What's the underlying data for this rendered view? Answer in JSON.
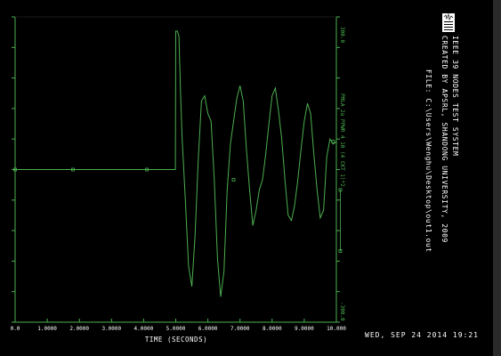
{
  "chart_data": {
    "type": "line",
    "title_lines": [
      "IEEE 39 NODES TEST SYSTEM",
      "CREATED BY APSRL, SHANDONG UNIVERSITY, 2009"
    ],
    "file_line": "FILE: C:\\Users\\Wenghu\\Desktop\\out1.out",
    "xlabel": "TIME (SECONDS)",
    "xlim": [
      0,
      10
    ],
    "x_ticks": [
      "0.0",
      "1.0000",
      "2.0000",
      "3.0000",
      "4.0000",
      "5.0000",
      "6.0000",
      "7.0000",
      "8.0000",
      "9.0000",
      "10.000"
    ],
    "ylim": [
      -300,
      300
    ],
    "y_top_label": "300.0",
    "y_bottom_label": "-300.0",
    "series": [
      {
        "name": "PMLA 2a PPWR  4 10  (4 CKT 1)*2",
        "color": "#4caf50",
        "x": [
          0,
          1.0,
          2.0,
          3.0,
          4.0,
          4.99,
          5.0,
          5.05,
          5.1,
          5.15,
          5.2,
          5.3,
          5.4,
          5.5,
          5.6,
          5.7,
          5.8,
          5.9,
          6.0,
          6.1,
          6.2,
          6.3,
          6.4,
          6.5,
          6.6,
          6.7,
          6.8,
          6.9,
          7.0,
          7.1,
          7.2,
          7.3,
          7.4,
          7.5,
          7.6,
          7.7,
          7.8,
          7.9,
          8.0,
          8.1,
          8.2,
          8.3,
          8.4,
          8.5,
          8.6,
          8.7,
          8.8,
          8.9,
          9.0,
          9.1,
          9.2,
          9.3,
          9.4,
          9.5,
          9.6,
          9.7,
          9.8,
          9.9,
          10.0
        ],
        "y": [
          0,
          0,
          0,
          0,
          0,
          0,
          272,
          272,
          262,
          150,
          60,
          -60,
          -190,
          -230,
          -130,
          20,
          135,
          145,
          110,
          95,
          -20,
          -175,
          -250,
          -200,
          -40,
          50,
          95,
          140,
          165,
          135,
          40,
          -40,
          -110,
          -80,
          -40,
          -20,
          30,
          90,
          145,
          160,
          115,
          60,
          -20,
          -90,
          -100,
          -70,
          -20,
          40,
          95,
          130,
          110,
          30,
          -40,
          -95,
          -80,
          25,
          60,
          50,
          55
        ]
      }
    ]
  }
}
